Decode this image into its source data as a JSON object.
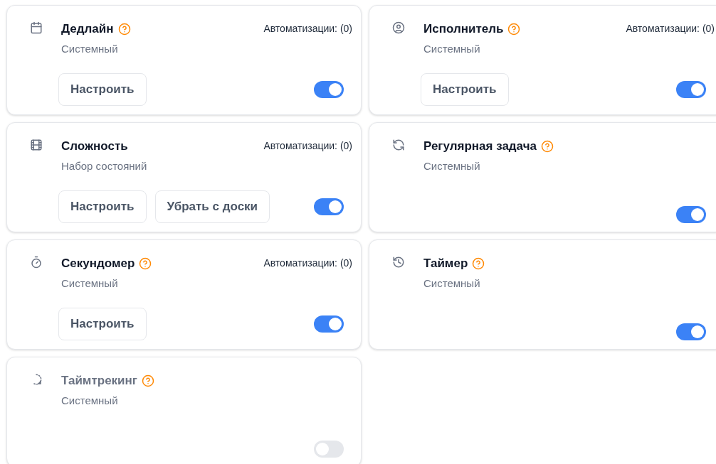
{
  "cards": [
    {
      "kind": "calendar",
      "title": "Дедлайн",
      "help": true,
      "subtitle": "Системный",
      "automations": "Автоматизации: (0)",
      "buttons": [
        "Настроить"
      ],
      "on": true
    },
    {
      "kind": "user",
      "title": "Исполнитель",
      "help": true,
      "subtitle": "Системный",
      "automations": "Автоматизации: (0)",
      "buttons": [
        "Настроить"
      ],
      "on": true
    },
    {
      "kind": "film",
      "title": "Сложность",
      "help": false,
      "subtitle": "Набор состояний",
      "automations": "Автоматизации: (0)",
      "buttons": [
        "Настроить",
        "Убрать с доски"
      ],
      "on": true
    },
    {
      "kind": "repeat",
      "title": "Регулярная задача",
      "help": true,
      "subtitle": "Системный",
      "on": true
    },
    {
      "kind": "stopwatch",
      "title": "Секундомер",
      "help": true,
      "subtitle": "Системный",
      "automations": "Автоматизации: (0)",
      "buttons": [
        "Настроить"
      ],
      "on": true
    },
    {
      "kind": "history",
      "title": "Таймер",
      "help": true,
      "subtitle": "Системный",
      "on": true
    },
    {
      "kind": "tracking",
      "title": "Таймтрекинг",
      "help": true,
      "subtitle": "Системный",
      "on": false
    }
  ]
}
